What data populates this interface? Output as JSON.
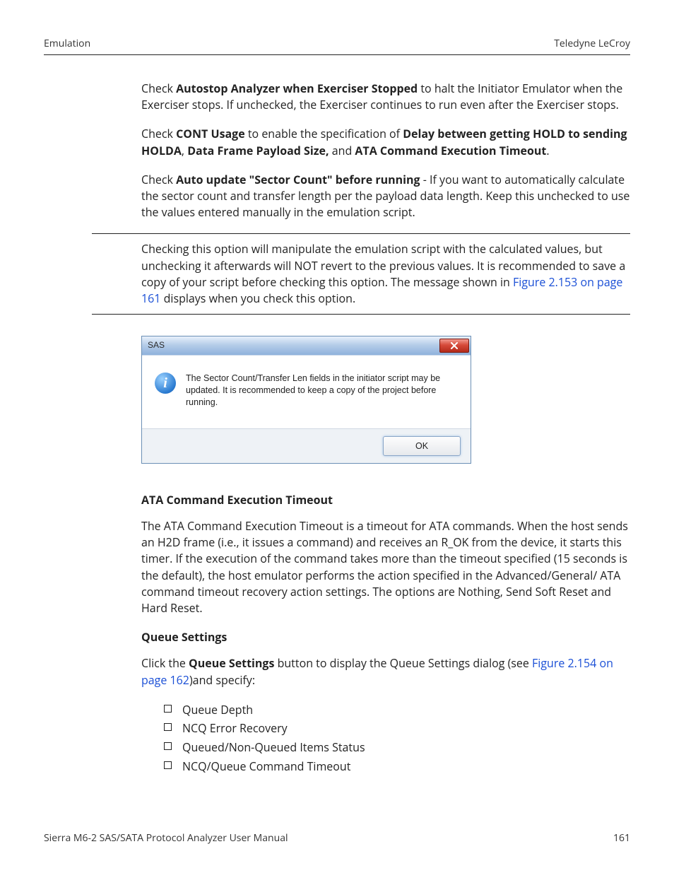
{
  "header": {
    "left": "Emulation",
    "right": "Teledyne LeCroy"
  },
  "p1": {
    "t1": "Check ",
    "b1": "Autostop Analyzer when Exerciser Stopped",
    "t2": " to halt the Initiator Emulator when the Exerciser stops. If unchecked, the Exerciser continues to run even after the Exerciser stops."
  },
  "p2": {
    "t1": "Check ",
    "b1": "CONT Usage",
    "t2": " to enable the specification of ",
    "b2": "Delay between getting HOLD to sending HOLDA",
    "t3": ", ",
    "b3": "Data Frame Payload Size,",
    "t4": " and ",
    "b4": "ATA Command Execution Timeout",
    "t5": "."
  },
  "p3": {
    "t1": "Check ",
    "b1": "Auto update \"Sector Count\" before running",
    "t2": " - If you want to automatically calculate the sector count and transfer length per the payload data length. Keep this unchecked to use the values entered manually in the emulation script."
  },
  "note": {
    "t1": "Checking this option will manipulate the emulation script with the calculated values, but unchecking it afterwards will NOT revert to the previous values. It is recommended to save a copy of your script before checking this option. The message shown in ",
    "link": "Figure 2.153 on page 161",
    "t2": " displays when you check this option."
  },
  "dialog": {
    "title": "SAS",
    "message": "The Sector Count/Transfer Len fields in the initiator script may be updated. It is recommended to keep a copy of the project before running.",
    "ok": "OK"
  },
  "ata": {
    "heading": "ATA Command Execution Timeout",
    "body": "The ATA Command Execution Timeout is a timeout for ATA commands. When the host sends an H2D frame (i.e., it issues a command) and receives an R_OK from the device, it starts this timer. If the execution of the command takes more than the timeout specified (15 seconds is the default), the host emulator performs the action specified in the Advanced/General/ ATA command timeout recovery action settings. The options are Nothing, Send Soft Reset and Hard Reset."
  },
  "queue": {
    "heading": "Queue Settings",
    "t1": "Click the ",
    "b1": "Queue Settings",
    "t2": " button to display the Queue Settings dialog (see ",
    "link": "Figure 2.154 on page 162",
    "t3": ")and specify:",
    "items": [
      "Queue Depth",
      "NCQ Error Recovery",
      "Queued/Non-Queued Items Status",
      "NCQ/Queue Command Timeout"
    ]
  },
  "footer": {
    "left": "Sierra M6-2 SAS/SATA Protocol Analyzer User Manual",
    "right": "161"
  }
}
